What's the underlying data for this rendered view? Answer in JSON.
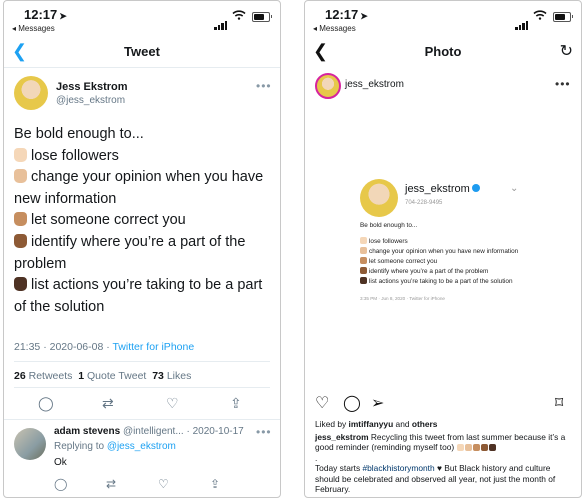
{
  "left": {
    "status": {
      "time": "12:17",
      "back_app": "◂ Messages"
    },
    "nav": {
      "title": "Tweet"
    },
    "author": {
      "name": "Jess Ekstrom",
      "handle": "@jess_ekstrom"
    },
    "tweet_lines": [
      "Be bold enough to...",
      "lose followers",
      "change your opinion when you have",
      "new information",
      "let someone correct you",
      "identify where you’re a part of the",
      "problem",
      "list actions you’re taking to be a part",
      "of the solution"
    ],
    "meta": {
      "time": "21:35 · 2020-06-08 ·",
      "source": "Twitter for iPhone"
    },
    "stats": {
      "retweets_count": "26",
      "retweets_label": "Retweets",
      "quotes_count": "1",
      "quotes_label": "Quote Tweet",
      "likes_count": "73",
      "likes_label": "Likes"
    },
    "reply": {
      "name": "adam stevens",
      "handle": "@intelligent...",
      "date": "· 2020-10-17",
      "replying_prefix": "Replying to",
      "replying_to": "@jess_ekstrom",
      "text": "Ok"
    },
    "skin_tones": [
      "#f5d7b8",
      "#e8c09a",
      "#c68e5f",
      "#8d5a35",
      "#4e3224"
    ]
  },
  "right": {
    "status": {
      "time": "12:17",
      "back_app": "◂ Messages"
    },
    "nav": {
      "title": "Photo"
    },
    "user": "jess_ekstrom",
    "photo": {
      "name": "jess_ekstrom",
      "phone": "704-228-9495",
      "lines": [
        "Be bold enough to...",
        "lose followers",
        "change your opinion when you have new information",
        "let someone correct you",
        "identify where you’re a part of the problem",
        "list actions you’re taking to be a part of the solution"
      ],
      "meta": "3:35 PM · Jun 8, 2020 · Twitter for iPhone"
    },
    "likes": {
      "prefix": "Liked by",
      "user": "imtiffanyyu",
      "and": "and",
      "others": "others"
    },
    "caption": {
      "user": "jess_ekstrom",
      "text1": "Recycling this tweet from last summer because it’s a good reminder (reminding myself too)",
      "dot": ".",
      "text2_pre": "Today starts",
      "hashtag": "#blackhistorymonth",
      "text2_post": "But Black history and culture should be celebrated and observed all year, not just the month of February."
    },
    "accent_blue": "#1da1f2"
  }
}
